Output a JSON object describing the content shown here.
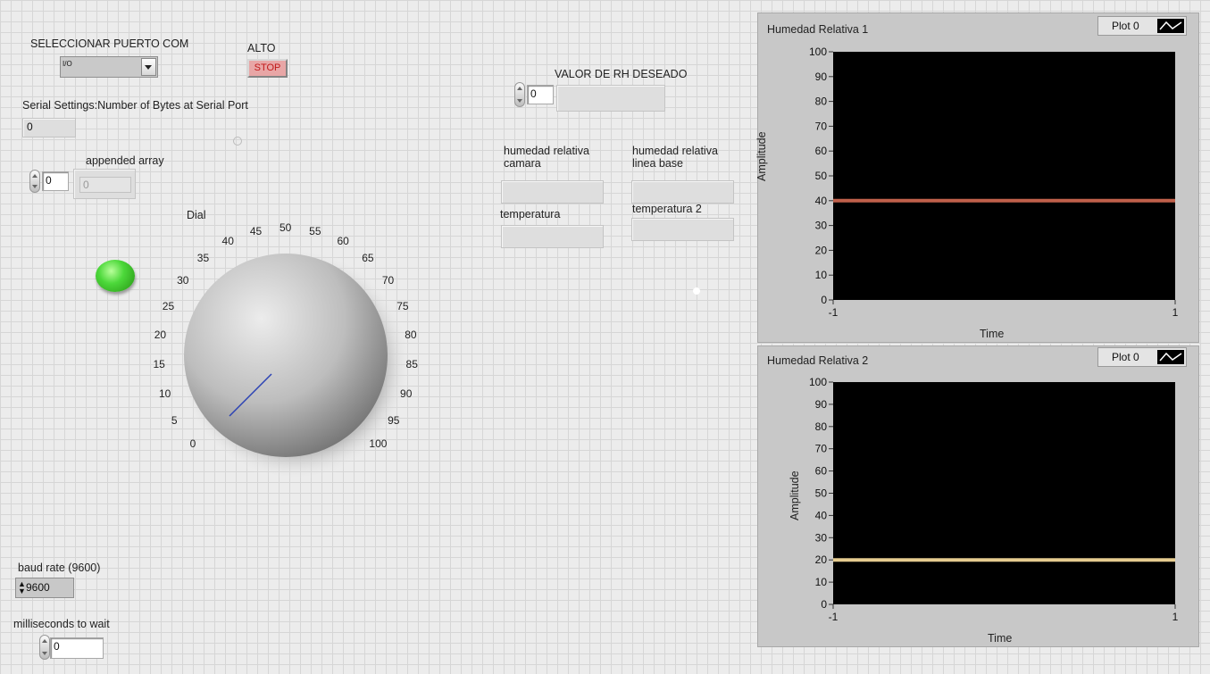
{
  "com_port": {
    "label": "SELECCIONAR PUERTO COM",
    "value": "",
    "prefix": "I/O"
  },
  "stop": {
    "label": "ALTO",
    "button_text": "STOP"
  },
  "serial_settings": {
    "label": "Serial Settings:Number of Bytes at Serial Port",
    "value": "0"
  },
  "appended": {
    "label": "appended array",
    "index": "0",
    "value": "0"
  },
  "dial": {
    "label": "Dial",
    "value": 0,
    "ticks": [
      "0",
      "5",
      "10",
      "15",
      "20",
      "25",
      "30",
      "35",
      "40",
      "45",
      "50",
      "55",
      "60",
      "65",
      "70",
      "75",
      "80",
      "85",
      "90",
      "95",
      "100"
    ]
  },
  "led": {
    "state": "on",
    "color": "#3fd43a"
  },
  "rh_setpoint": {
    "label": "VALOR DE RH  DESEADO",
    "value": "0",
    "display": ""
  },
  "indicators": {
    "hr_camara": {
      "label": "humedad relativa camara",
      "value": ""
    },
    "hr_linea": {
      "label": "humedad relativa linea base",
      "value": ""
    },
    "temp1": {
      "label": "temperatura",
      "value": ""
    },
    "temp2": {
      "label": "temperatura 2",
      "value": ""
    }
  },
  "baud": {
    "label": "baud rate (9600)",
    "value": "9600"
  },
  "wait": {
    "label": "milliseconds to wait",
    "value": "0"
  },
  "chart_data": [
    {
      "type": "line",
      "title": "Humedad Relativa 1",
      "legend": "Plot 0",
      "xlabel": "Time",
      "ylabel": "Amplitude",
      "xlim": [
        -1,
        1
      ],
      "ylim": [
        0,
        100
      ],
      "yticks": [
        "0",
        "10",
        "20",
        "30",
        "40",
        "50",
        "60",
        "70",
        "80",
        "90",
        "100"
      ],
      "xticks": [
        "-1",
        "1"
      ],
      "series": [
        {
          "name": "Plot 0",
          "color": "#c0604a",
          "x": [
            -1,
            1
          ],
          "y": [
            40,
            40
          ]
        }
      ]
    },
    {
      "type": "line",
      "title": "Humedad Relativa 2",
      "legend": "Plot 0",
      "xlabel": "Time",
      "ylabel": "Amplitude",
      "xlim": [
        -1,
        1
      ],
      "ylim": [
        0,
        100
      ],
      "yticks": [
        "0",
        "10",
        "20",
        "30",
        "40",
        "50",
        "60",
        "70",
        "80",
        "90",
        "100"
      ],
      "xticks": [
        "-1",
        "1"
      ],
      "series": [
        {
          "name": "Plot 0",
          "color": "#e6cc90",
          "x": [
            -1,
            1
          ],
          "y": [
            20,
            20
          ]
        }
      ]
    }
  ]
}
